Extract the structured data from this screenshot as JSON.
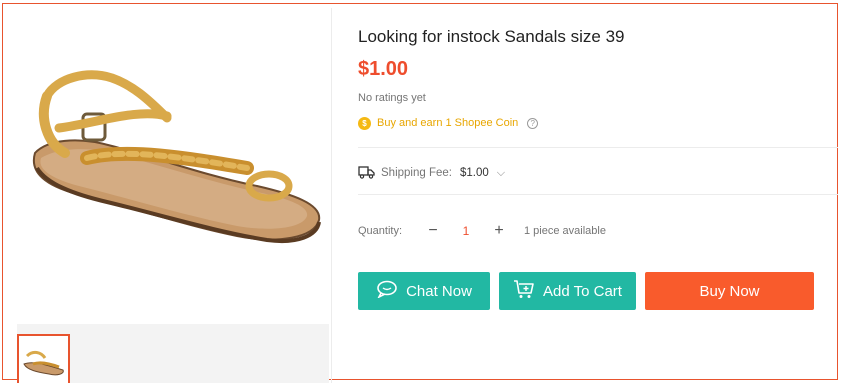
{
  "product": {
    "title": "Looking for instock Sandals size 39",
    "price": "$1.00",
    "ratings": "No ratings yet",
    "coin_text": "Buy and earn 1 Shopee Coin"
  },
  "shipping": {
    "label": "Shipping Fee:",
    "value": "$1.00"
  },
  "quantity": {
    "label": "Quantity:",
    "minus": "−",
    "value": "1",
    "plus": "+",
    "available": "1 piece available"
  },
  "actions": {
    "chat": "Chat Now",
    "cart": "Add To Cart",
    "buy": "Buy Now"
  },
  "colors": {
    "accent": "#ee4d2d",
    "teal": "#22b8a3",
    "buy": "#f95b2c",
    "coin": "#f5b914"
  },
  "icons": {
    "chat": "chat-bubble-icon",
    "cart": "cart-icon",
    "shipping": "truck-icon",
    "coin": "coin-icon",
    "help": "question-icon",
    "dropdown": "chevron-down-icon"
  }
}
